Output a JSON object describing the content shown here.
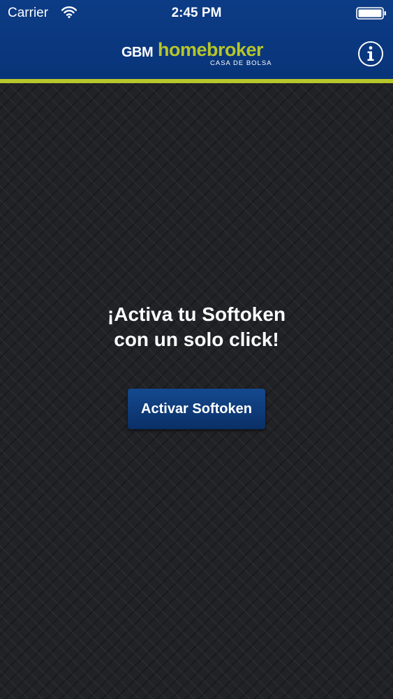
{
  "status_bar": {
    "carrier": "Carrier",
    "time": "2:45 PM",
    "wifi_icon": "wifi-icon",
    "battery_icon": "battery-icon"
  },
  "nav_bar": {
    "logo": {
      "gbm": "GBM",
      "homebroker": "homebroker",
      "subtitle": "CASA DE BOLSA"
    },
    "info_button_icon": "info-icon"
  },
  "main": {
    "headline_line1": "¡Activa tu Softoken",
    "headline_line2": "con un solo click!",
    "activate_button_label": "Activar Softoken"
  },
  "colors": {
    "header_blue": "#0b3a82",
    "accent_green": "#b7c62a",
    "background_dark": "#212226",
    "button_blue": "#0f3f80",
    "text_white": "#ffffff"
  }
}
